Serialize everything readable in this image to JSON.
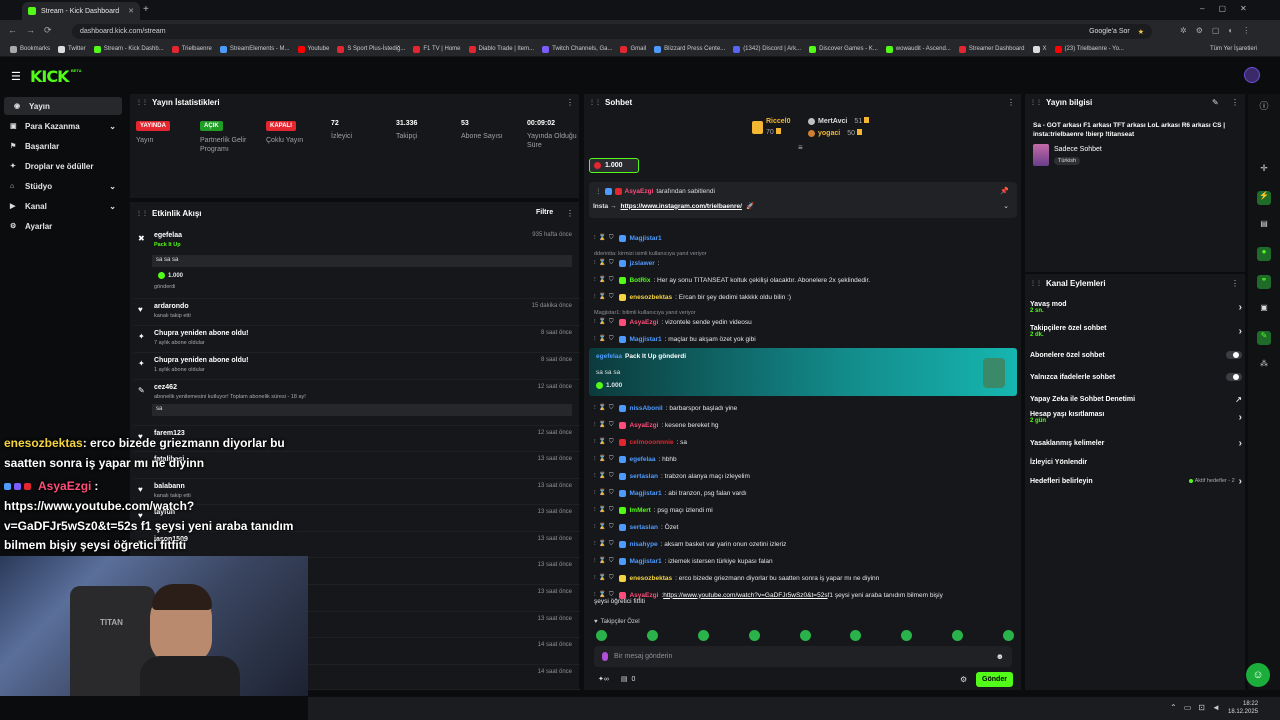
{
  "browser": {
    "tab_title": "Stream - Kick Dashboard",
    "url": "dashboard.kick.com/stream",
    "search_button": "Google'a Sor",
    "bookmarks": [
      "Bookmarks",
      "Twitter",
      "Stream - Kick Dashb...",
      "Trielbaenre",
      "StreamElements - M...",
      "Youtube",
      "S Sport Plus-İstediğ...",
      "F1 TV | Home",
      "Diablo Trade | Item...",
      "Twitch Channels, Ga...",
      "Gmail",
      "Blizzard Press Cente...",
      "(1342) Discord | Ark...",
      "Discover Games - K...",
      "wowaudit - Ascend...",
      "Streamer Dashboard",
      "X",
      "(23) Trielbaenre - Yo..."
    ],
    "all_bookmarks": "Tüm Yer İşaretleri"
  },
  "brand": {
    "logo": "KICK",
    "beta": "BETA",
    "accent": "#53fc18"
  },
  "sidebar": {
    "items": [
      {
        "label": "Yayın",
        "icon": "broadcast-icon"
      },
      {
        "label": "Para Kazanma",
        "icon": "wallet-icon"
      },
      {
        "label": "Başarılar",
        "icon": "trophy-icon"
      },
      {
        "label": "Droplar ve ödüller",
        "icon": "gift-icon"
      },
      {
        "label": "Stüdyo",
        "icon": "studio-icon"
      },
      {
        "label": "Kanal",
        "icon": "channel-icon"
      },
      {
        "label": "Ayarlar",
        "icon": "gear-icon"
      }
    ]
  },
  "stats": {
    "title": "Yayın İstatistikleri",
    "items": [
      {
        "badge": "YAYINDA",
        "label": "Yayın",
        "color": "#e3262f"
      },
      {
        "badge": "AÇIK",
        "label": "Partnerlik Gelir Programı",
        "color": "#1f9d24"
      },
      {
        "badge": "KAPALI",
        "label": "Çoklu Yayın",
        "color": "#e3262f"
      },
      {
        "value": "72",
        "label": "İzleyici"
      },
      {
        "value": "31.336",
        "label": "Takipçi"
      },
      {
        "value": "53",
        "label": "Abone Sayısı"
      },
      {
        "value": "00:09:02",
        "label": "Yayında Olduğu Süre"
      }
    ]
  },
  "feed": {
    "title": "Etkinlik Akışı",
    "filter": "Filtre",
    "items": [
      {
        "title": "egefelaa",
        "sub": "Pack It Up",
        "time": "935 hafta önce",
        "message": "sa sa sa",
        "amount": "1.000",
        "note": "gönderdi"
      },
      {
        "title": "ardarondo",
        "sub": "kanalı takip etti",
        "time": "15 dakika önce"
      },
      {
        "title": "Chupra yeniden abone oldu!",
        "sub": "7 aylık abone oldular",
        "time": "8 saat önce"
      },
      {
        "title": "Chupra yeniden abone oldu!",
        "sub": "1 aylık abone oldular",
        "time": "8 saat önce"
      },
      {
        "title": "cez462",
        "sub": "abonelik yenilemesini kutluyor! Toplam abonelik süresi - 18 ay!",
        "time": "12 saat önce",
        "message": "sa"
      },
      {
        "title": "farem123",
        "sub": "",
        "time": "12 saat önce"
      },
      {
        "title": "fatalibasi",
        "sub": "",
        "time": "13 saat önce"
      },
      {
        "title": "balabann",
        "sub": "kanalı takip etti",
        "time": "13 saat önce"
      },
      {
        "title": "tayfun",
        "sub": "",
        "time": "13 saat önce"
      },
      {
        "title": "jason1509",
        "sub": "",
        "time": "13 saat önce"
      },
      {
        "title": "",
        "sub": "",
        "time": "13 saat önce"
      },
      {
        "title": "",
        "sub": "",
        "time": "13 saat önce"
      },
      {
        "title": "",
        "sub": "",
        "time": "13 saat önce"
      },
      {
        "title": "",
        "sub": "",
        "time": "14 saat önce"
      },
      {
        "title": "",
        "sub": "- 3 ay!",
        "time": "14 saat önce"
      }
    ]
  },
  "overlay": {
    "line1_user": "enesozbektas",
    "line1_text": ": erco bizede griezmann diyorlar bu",
    "line2": "saatten sonra iş yapar mı ne diyinn",
    "line3_user": "AsyaEzgi",
    "line3_colon": ":",
    "line4": "https://www.youtube.com/watch?",
    "line5": "v=GaDFJr5wSz0&t=52s f1 şeysi yeni araba tanıdım",
    "line6": "bilmem bişiy şeysi öğretici fitfiti"
  },
  "chat": {
    "title": "Sohbet",
    "leaders": [
      {
        "name": "Riccel0",
        "value": "70"
      },
      {
        "name": "MertAvci",
        "value": "51"
      },
      {
        "name": "yogaci",
        "value": "50"
      }
    ],
    "goal": "1.000",
    "pinned_by": "AsyaEzgi",
    "pinned_label": "tarafından sabitlendi",
    "pinned_prefix": "Insta →",
    "pinned_link": "https://www.instagram.com/trielbaenre/",
    "pack": {
      "user": "egefelaa",
      "text": "Pack It Up gönderdi",
      "message": "sa sa sa",
      "amount": "1.000"
    },
    "messages_top": [
      {
        "user": "Magjistar1",
        "text": "",
        "color": "#4e9bff"
      },
      {
        "user": "",
        "text": "dderintia: kirmizi isimli kullanıcıya yanıt veriyor",
        "reply": true
      },
      {
        "user": "jzslawer",
        "text": ":",
        "color": "#4e9bff"
      },
      {
        "user": "BotRix",
        "text": ": Her ay sonu TITANSEAT koltuk çekilişi olacaktır. Abonelere 2x şeklindedir.",
        "color": "#53fc18"
      },
      {
        "user": "enesozbektas",
        "text": ": Ercan bir şey dedimi takkkk oldu bilin :)",
        "color": "#f5d442"
      },
      {
        "user": "",
        "text": "Magjistar1: bitimli kullanıcıya yanıt veriyor",
        "reply": true
      },
      {
        "user": "AsyaEzgi",
        "text": ": vizontele sende yedin videosu",
        "color": "#ff4d7a"
      },
      {
        "user": "Magjistar1",
        "text": ": maçlar bu akşam özet yok gibi",
        "color": "#4e9bff"
      }
    ],
    "messages": [
      {
        "user": "nissAbonil",
        "text": ": barbarspor başladı yine",
        "color": "#4e9bff"
      },
      {
        "user": "AsyaEzgi",
        "text": ": kesene bereket hg",
        "color": "#ff4d7a"
      },
      {
        "user": "celmooonnnie",
        "text": ": sa",
        "color": "#e3262f"
      },
      {
        "user": "egefelaa",
        "text": ": hbhb",
        "color": "#4e9bff"
      },
      {
        "user": "sertaslan",
        "text": ": trabzon alanya maçı izleyelim",
        "color": "#4e9bff"
      },
      {
        "user": "Magjistar1",
        "text": ": abi tranzon, psg falan vardı",
        "color": "#4e9bff"
      },
      {
        "user": "ImMert",
        "text": ": psg maçı izlendi mi",
        "color": "#53fc18"
      },
      {
        "user": "sertaslan",
        "text": ": Özet",
        "color": "#4e9bff"
      },
      {
        "user": "nisahype",
        "text": ": aksam basket var yarin onun ozetini izleriz",
        "color": "#4e9bff"
      },
      {
        "user": "Magjistar1",
        "text": ": izlemek istersen türkiye kupası falan",
        "color": "#4e9bff"
      },
      {
        "user": "enesozbektas",
        "text": ": erco bizede griezmann diyorlar bu saatten sonra iş yapar mı ne diyinn",
        "color": "#f5d442"
      },
      {
        "user": "AsyaEzgi",
        "text": ": ",
        "color": "#ff4d7a",
        "link": "https://www.youtube.com/watch?v=GaDFJr5wSz0&t=52s",
        "after": " f1 şeysi yeni araba tanıdım bilmem bişiy",
        "wrap": "şeysi öğretici fitfiti"
      }
    ],
    "followers_only": "Takipçiler Özel",
    "input_placeholder": "Bir mesaj gönderin",
    "counter": "0",
    "send": "Gönder"
  },
  "stream_info": {
    "title": "Yayın bilgisi",
    "stream_title": "Sa - GOT arkası F1 arkası TFT arkası LoL arkası R6 arkası CS | insta:trielbaenre !bierp !titanseat",
    "category": "Sadece Sohbet",
    "tag": "Türkish"
  },
  "channel_actions": {
    "title": "Kanal Eylemleri",
    "items": [
      {
        "label": "Yavaş mod",
        "sub": "2 sn.",
        "kind": "chevron"
      },
      {
        "label": "Takipçilere özel sohbet",
        "sub": "2 dk.",
        "kind": "chevron"
      },
      {
        "label": "Abonelere özel sohbet",
        "kind": "toggle"
      },
      {
        "label": "Yalnızca ifadelerle sohbet",
        "kind": "toggle"
      },
      {
        "label": "Yapay Zeka ile Sohbet Denetimi",
        "kind": "external"
      },
      {
        "label": "Hesap yaşı kısıtlaması",
        "sub": "2 gün",
        "kind": "chevron"
      },
      {
        "label": "Yasaklanmış kelimeler",
        "kind": "chevron"
      },
      {
        "label": "İzleyici Yönlendir",
        "kind": "none"
      },
      {
        "label": "Hedefleri belirleyin",
        "extra": "Aktif hedefler - 2",
        "kind": "chevron"
      }
    ]
  },
  "taskbar": {
    "time": "18:22",
    "date": "18.12.2025"
  }
}
